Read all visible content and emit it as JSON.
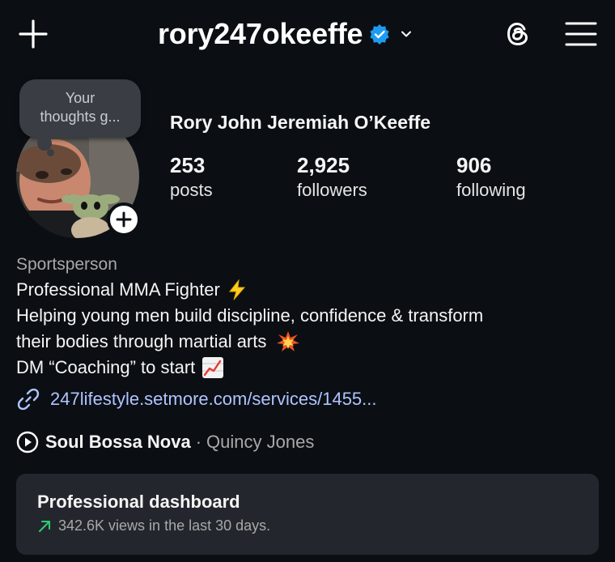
{
  "header": {
    "username": "rory247okeeffe",
    "icons": [
      "plus-icon",
      "verified-badge-icon",
      "chevron-down-icon",
      "threads-icon",
      "hamburger-menu-icon"
    ],
    "verified_color": "#1d9bf0"
  },
  "note": {
    "line1": "Your",
    "line2": "thoughts g..."
  },
  "profile": {
    "full_name": "Rory John Jeremiah O’Keeffe",
    "stats": [
      {
        "value": "253",
        "label": "posts"
      },
      {
        "value": "2,925",
        "label": "followers"
      },
      {
        "value": "906",
        "label": "following"
      }
    ]
  },
  "bio": {
    "category": "Sportsperson",
    "lines": [
      "Professional MMA Fighter",
      "Helping young men build discipline, confidence & transform",
      "their bodies through martial arts",
      "DM “Coaching” to start"
    ],
    "emojis": [
      "lightning-emoji",
      "collision-emoji",
      "chart-increasing-emoji"
    ]
  },
  "link": {
    "text": "247lifestyle.setmore.com/services/1455...",
    "color": "#b0c4ff"
  },
  "music": {
    "song": "Soul Bossa Nova",
    "separator": "·",
    "artist": "Quincy Jones"
  },
  "dashboard": {
    "title": "Professional dashboard",
    "subtitle": "342.6K views in the last 30 days.",
    "trend_color": "#2ecc71"
  }
}
